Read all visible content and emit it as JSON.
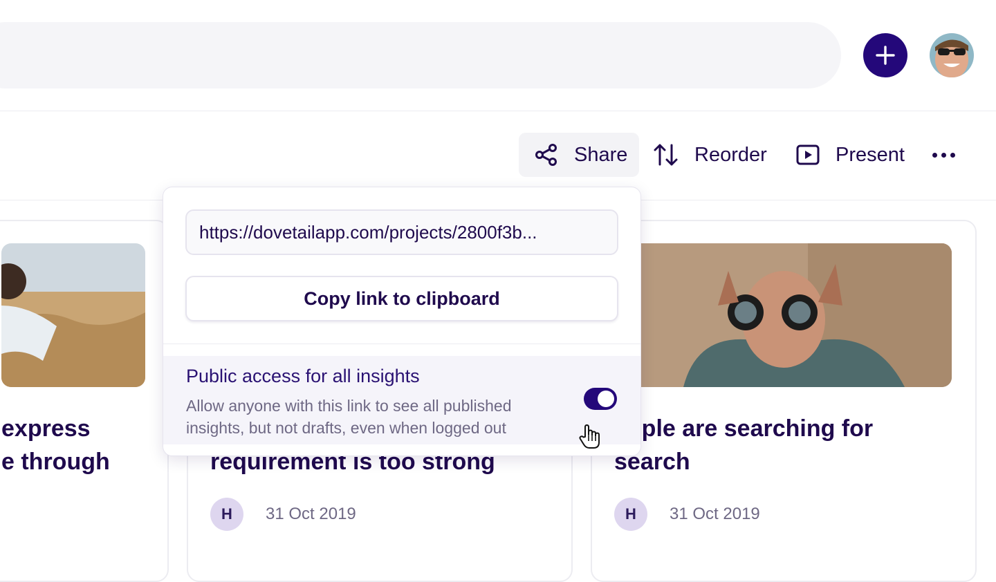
{
  "header": {
    "add_icon": "plus-icon",
    "avatar_icon": "user-avatar-photo"
  },
  "toolbar": {
    "share_label": "Share",
    "reorder_label": "Reorder",
    "present_label": "Present",
    "more_icon": "more-horizontal-icon"
  },
  "cards": [
    {
      "title_lines": [
        "express",
        "e through"
      ]
    },
    {
      "title_lines": [
        "requirement is too strong"
      ],
      "author_initial": "H",
      "date": "31 Oct 2019"
    },
    {
      "title_lines": [
        "eople are searching for",
        "search"
      ],
      "author_initial": "H",
      "date": "31 Oct 2019"
    }
  ],
  "share_popover": {
    "url": "https://dovetailapp.com/projects/2800f3b...",
    "copy_label": "Copy link to clipboard",
    "public_access": {
      "title": "Public access for all insights",
      "description": "Allow anyone with this link to see all published insights, but not drafts, even when logged out",
      "enabled": true
    }
  },
  "colors": {
    "brand": "#24087a",
    "text": "#1f0a4d",
    "muted": "#6e6884"
  }
}
